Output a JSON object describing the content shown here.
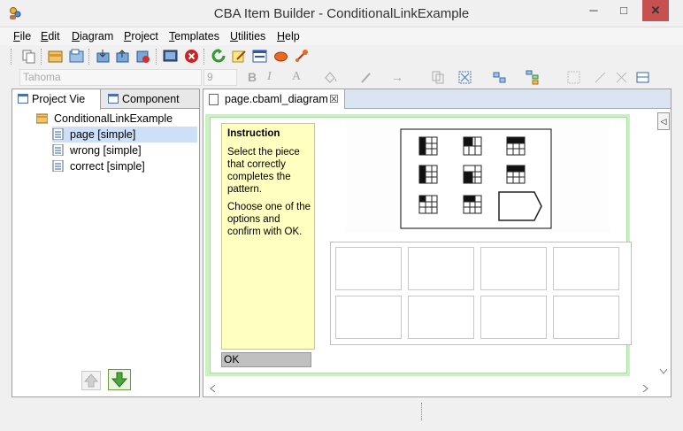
{
  "window": {
    "title": "CBA Item Builder - ConditionalLinkExample",
    "minimize": "─",
    "maximize": "□",
    "close": "✕"
  },
  "menu": [
    "File",
    "Edit",
    "Diagram",
    "Project",
    "Templates",
    "Utilities",
    "Help"
  ],
  "format_toolbar": {
    "font": "Tahoma",
    "size": "9",
    "bold": "B",
    "italic": "I",
    "font_color": "A",
    "arrow_glyph": "→"
  },
  "left_panel": {
    "tabs": [
      "Project Vie",
      "Component"
    ],
    "tree": {
      "root": "ConditionalLinkExample",
      "items": [
        "page [simple]",
        "wrong [simple]",
        "correct [simple]"
      ]
    }
  },
  "editor": {
    "tab_label": "page.cbaml_diagram",
    "tab_close": "☒",
    "instruction": {
      "title": "Instruction",
      "text1": "Select the piece that correctly completes the pattern.",
      "text2": "Choose one of the options and confirm with OK."
    },
    "ok_label": "OK",
    "side_marker": "◁"
  },
  "colors": {
    "canvas_bg": "#c9f2c0",
    "instruction_bg": "#ffffc0",
    "selection": "#cde0f7",
    "close_button": "#c75050"
  }
}
